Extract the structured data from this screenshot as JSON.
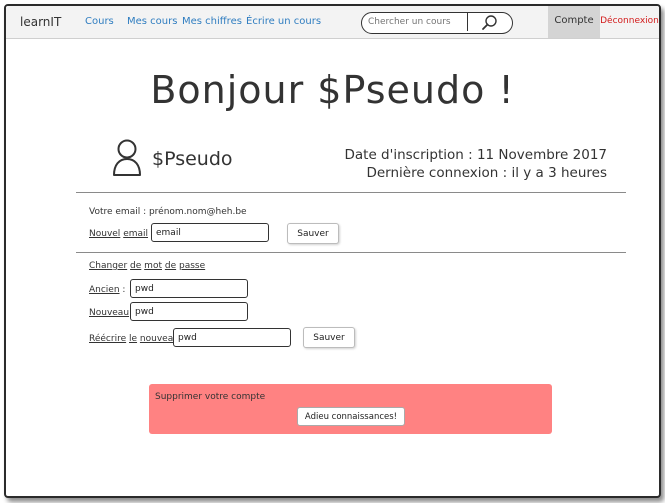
{
  "navbar": {
    "brand": "learnIT",
    "links": [
      "Cours",
      "Mes cours",
      "Mes chiffres",
      "Écrire un cours"
    ],
    "search_placeholder": "Chercher un cours",
    "account_label": "Compte",
    "logout_label": "Déconnexion"
  },
  "main": {
    "title": "Bonjour $Pseudo !",
    "username": "$Pseudo",
    "signup": "Date d'inscription : 11 Novembre 2017",
    "last_login": "Dernière connexion : il y a 3 heures"
  },
  "email_section": {
    "current": "Votre email : prénom.nom@heh.be",
    "new_label_1": "Nouvel",
    "new_label_2": "email",
    "new_value": "email",
    "save_label": "Sauver"
  },
  "password_section": {
    "heading_words": [
      "Changer",
      "de",
      "mot",
      "de",
      "passe"
    ],
    "old_label": "Ancien",
    "old_value": "pwd",
    "new_label": "Nouveau",
    "new_value": "pwd",
    "repeat_words": [
      "Réécrire",
      "le",
      "nouveau"
    ],
    "repeat_value": "pwd",
    "save_label": "Sauver"
  },
  "danger": {
    "title": "Supprimer votre compte",
    "button_label": "Adieu connaissances!",
    "color": "#ff8282"
  },
  "colors": {
    "link": "#2f7dc0",
    "logout": "#d31c1c",
    "active_tab": "#d4d4d4"
  },
  "icons": {
    "search": "magnifier-icon",
    "user": "user-outline-icon"
  }
}
